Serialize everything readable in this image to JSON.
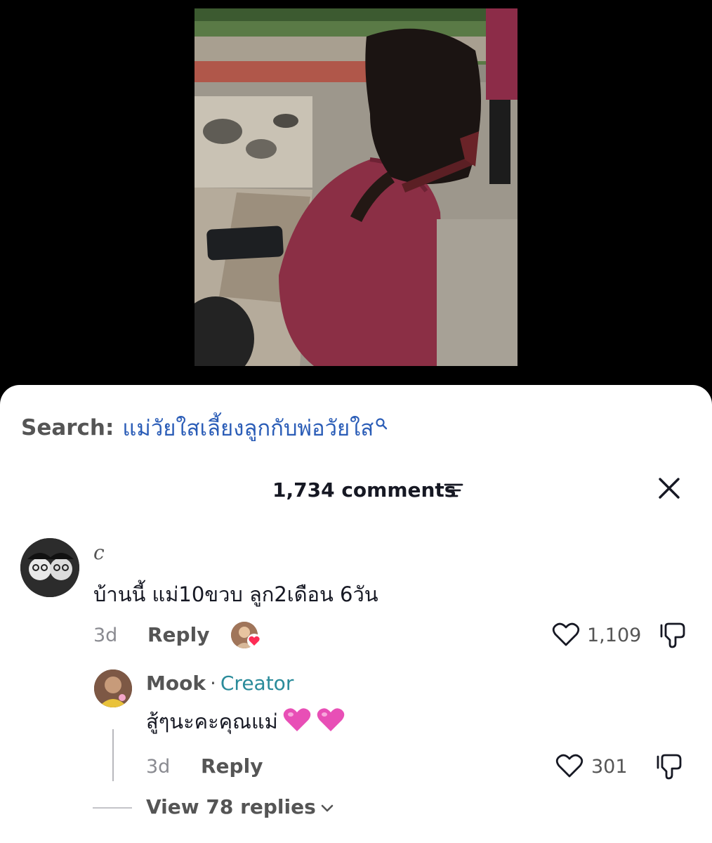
{
  "search": {
    "prefix": "Search:",
    "term": "แม่วัยใสเลี้ยงลูกกับพ่อวัยใส"
  },
  "header": {
    "comment_count": "1,734 comments"
  },
  "comment": {
    "username": "c",
    "text": "บ้านนี้ แม่10ขวบ ลูก2เดือน 6วัน",
    "time": "3d",
    "reply_label": "Reply",
    "likes": "1,109"
  },
  "reply": {
    "username": "Mook",
    "separator": "·",
    "badge": "Creator",
    "text": "สู้ๆนะคะคุณแม่",
    "time": "3d",
    "reply_label": "Reply",
    "likes": "301"
  },
  "view_replies": "View 78 replies",
  "colors": {
    "search_term": "#2b5db7",
    "creator_badge": "#2a8b9a",
    "liker_heart": "#fe2c55",
    "heart_emoji": "#e84fb6"
  }
}
